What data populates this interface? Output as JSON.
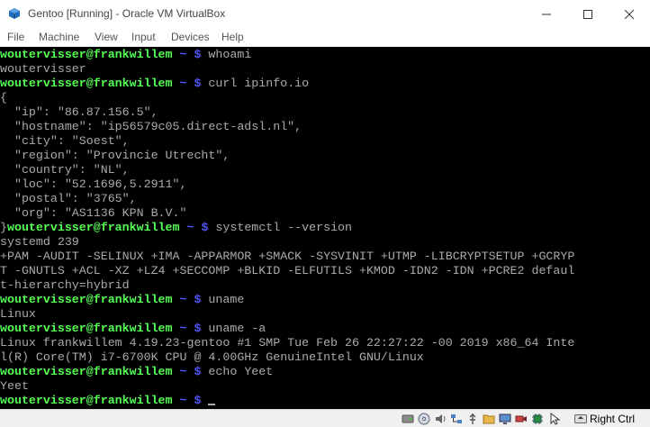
{
  "window": {
    "title": "Gentoo [Running] - Oracle VM VirtualBox",
    "icon": "virtualbox-icon"
  },
  "menu": [
    "File",
    "Machine",
    "View",
    "Input",
    "Devices",
    "Help"
  ],
  "terminal": {
    "prompt_user": "woutervisser@frankwillem",
    "prompt_path": " ~ $",
    "lines": [
      {
        "type": "prompt",
        "prefix": "",
        "cmd": " whoami"
      },
      {
        "type": "output",
        "text": "woutervisser"
      },
      {
        "type": "prompt",
        "prefix": "",
        "cmd": " curl ipinfo.io"
      },
      {
        "type": "output",
        "text": "{"
      },
      {
        "type": "output",
        "text": "  \"ip\": \"86.87.156.5\","
      },
      {
        "type": "output",
        "text": "  \"hostname\": \"ip56579c05.direct-adsl.nl\","
      },
      {
        "type": "output",
        "text": "  \"city\": \"Soest\","
      },
      {
        "type": "output",
        "text": "  \"region\": \"Provincie Utrecht\","
      },
      {
        "type": "output",
        "text": "  \"country\": \"NL\","
      },
      {
        "type": "output",
        "text": "  \"loc\": \"52.1696,5.2911\","
      },
      {
        "type": "output",
        "text": "  \"postal\": \"3765\","
      },
      {
        "type": "output",
        "text": "  \"org\": \"AS1136 KPN B.V.\""
      },
      {
        "type": "prompt",
        "prefix": "}",
        "cmd": " systemctl --version"
      },
      {
        "type": "output",
        "text": "systemd 239"
      },
      {
        "type": "output",
        "text": "+PAM -AUDIT -SELINUX +IMA -APPARMOR +SMACK -SYSVINIT +UTMP -LIBCRYPTSETUP +GCRYP"
      },
      {
        "type": "output",
        "text": "T -GNUTLS +ACL -XZ +LZ4 +SECCOMP +BLKID -ELFUTILS +KMOD -IDN2 -IDN +PCRE2 defaul"
      },
      {
        "type": "output",
        "text": "t-hierarchy=hybrid"
      },
      {
        "type": "prompt",
        "prefix": "",
        "cmd": " uname"
      },
      {
        "type": "output",
        "text": "Linux"
      },
      {
        "type": "prompt",
        "prefix": "",
        "cmd": " uname -a"
      },
      {
        "type": "output",
        "text": "Linux frankwillem 4.19.23-gentoo #1 SMP Tue Feb 26 22:27:22 -00 2019 x86_64 Inte"
      },
      {
        "type": "output",
        "text": "l(R) Core(TM) i7-6700K CPU @ 4.00GHz GenuineIntel GNU/Linux"
      },
      {
        "type": "prompt",
        "prefix": "",
        "cmd": " echo Yeet"
      },
      {
        "type": "output",
        "text": "Yeet"
      },
      {
        "type": "prompt",
        "prefix": "",
        "cmd": " ",
        "cursor": true
      }
    ]
  },
  "statusbar": {
    "icons": [
      "hard-disk-icon",
      "optical-drive-icon",
      "audio-icon",
      "network-icon",
      "usb-icon",
      "shared-folders-icon",
      "display-icon",
      "video-capture-icon",
      "cpu-icon",
      "mouse-integration-icon"
    ],
    "host_key": "Right Ctrl",
    "colors": {
      "terminal_bg": "#000000",
      "prompt_user": "#55ff55",
      "prompt_path": "#5555ff",
      "text": "#aaaaaa"
    }
  }
}
